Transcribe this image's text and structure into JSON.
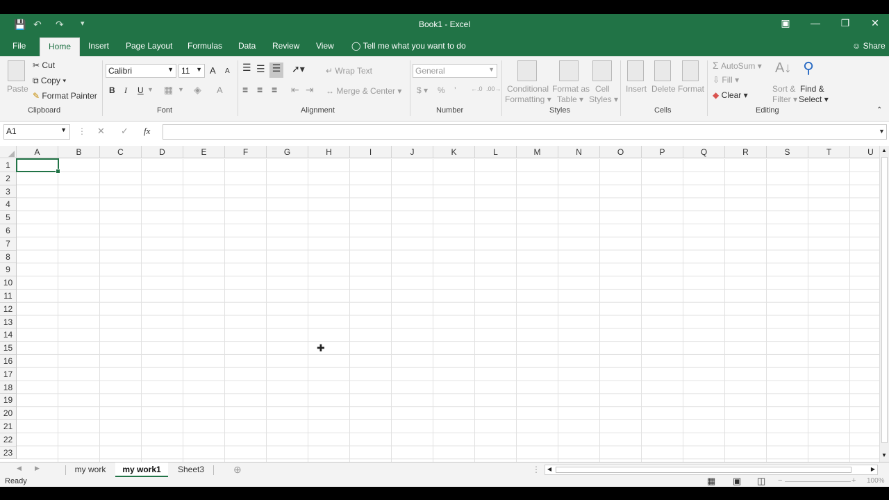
{
  "window": {
    "title": "Book1  -  Excel"
  },
  "tabs": [
    "File",
    "Home",
    "Insert",
    "Page Layout",
    "Formulas",
    "Data",
    "Review",
    "View"
  ],
  "tell_me": "Tell me what you want to do",
  "share": "Share",
  "clipboard": {
    "paste": "Paste",
    "cut": "Cut",
    "copy": "Copy",
    "format_painter": "Format Painter",
    "label": "Clipboard"
  },
  "font": {
    "name": "Calibri",
    "size": "11",
    "bold": "B",
    "italic": "I",
    "underline": "U",
    "grow": "A",
    "shrink": "A",
    "color": "A",
    "label": "Font"
  },
  "alignment": {
    "wrap": "Wrap Text",
    "merge": "Merge & Center",
    "label": "Alignment"
  },
  "number": {
    "format": "General",
    "currency": "$",
    "percent": "%",
    "comma": "’",
    "label": "Number"
  },
  "styles": {
    "cond1": "Conditional",
    "cond2": "Formatting",
    "fmt1": "Format as",
    "fmt2": "Table",
    "cell1": "Cell",
    "cell2": "Styles",
    "label": "Styles"
  },
  "cells": {
    "insert": "Insert",
    "delete": "Delete",
    "format": "Format",
    "label": "Cells"
  },
  "editing": {
    "autosum": "AutoSum",
    "fill": "Fill",
    "clear": "Clear",
    "sort1": "Sort &",
    "sort2": "Filter",
    "find1": "Find &",
    "find2": "Select",
    "label": "Editing"
  },
  "formula_bar": {
    "name_box": "A1",
    "fx": "fx",
    "cancel": "✕",
    "enter": "✓",
    "value": ""
  },
  "columns": [
    "A",
    "B",
    "C",
    "D",
    "E",
    "F",
    "G",
    "H",
    "I",
    "J",
    "K",
    "L",
    "M",
    "N",
    "O",
    "P",
    "Q",
    "R",
    "S",
    "T",
    "U"
  ],
  "rows": [
    "1",
    "2",
    "3",
    "4",
    "5",
    "6",
    "7",
    "8",
    "9",
    "10",
    "11",
    "12",
    "13",
    "14",
    "15",
    "16",
    "17",
    "18",
    "19",
    "20",
    "21",
    "22",
    "23"
  ],
  "sheets": [
    "my work",
    "my work1",
    "Sheet3"
  ],
  "active_sheet": "my work1",
  "status": {
    "ready": "Ready",
    "zoom": "100%"
  },
  "colors": {
    "accent": "#217346"
  }
}
